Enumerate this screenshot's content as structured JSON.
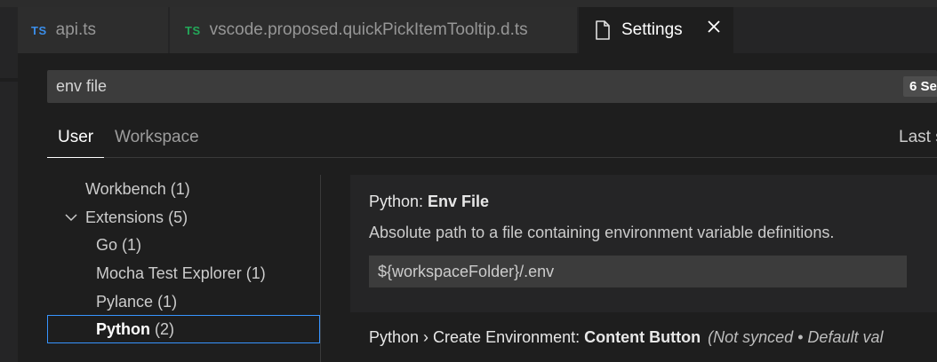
{
  "tabs": [
    {
      "icon": "TS",
      "label": "api.ts"
    },
    {
      "icon": "TS",
      "label": "vscode.proposed.quickPickItemTooltip.d.ts"
    },
    {
      "icon": "file-icon",
      "label": "Settings"
    }
  ],
  "search": {
    "value": "env file",
    "results_badge": "6 Se"
  },
  "scope_tabs": {
    "user": "User",
    "workspace": "Workspace",
    "last_synced": "Last s"
  },
  "toc": {
    "workbench": {
      "label": "Workbench",
      "count": "(1)"
    },
    "extensions": {
      "label": "Extensions",
      "count": "(5)"
    },
    "go": {
      "label": "Go",
      "count": "(1)"
    },
    "mocha": {
      "label": "Mocha Test Explorer",
      "count": "(1)"
    },
    "pylance": {
      "label": "Pylance",
      "count": "(1)"
    },
    "python": {
      "label": "Python",
      "count": "(2)"
    }
  },
  "settings": [
    {
      "category": "Python: ",
      "name": "Env File",
      "description": "Absolute path to a file containing environment variable definitions.",
      "value": "${workspaceFolder}/.env"
    },
    {
      "category": "Python › Create Environment: ",
      "name": "Content Button",
      "meta": "(Not synced • Default val"
    }
  ],
  "colors": {
    "accent_focus": "#3794ff",
    "ts_blue": "#3b8eea",
    "ts_green": "#23a859"
  }
}
